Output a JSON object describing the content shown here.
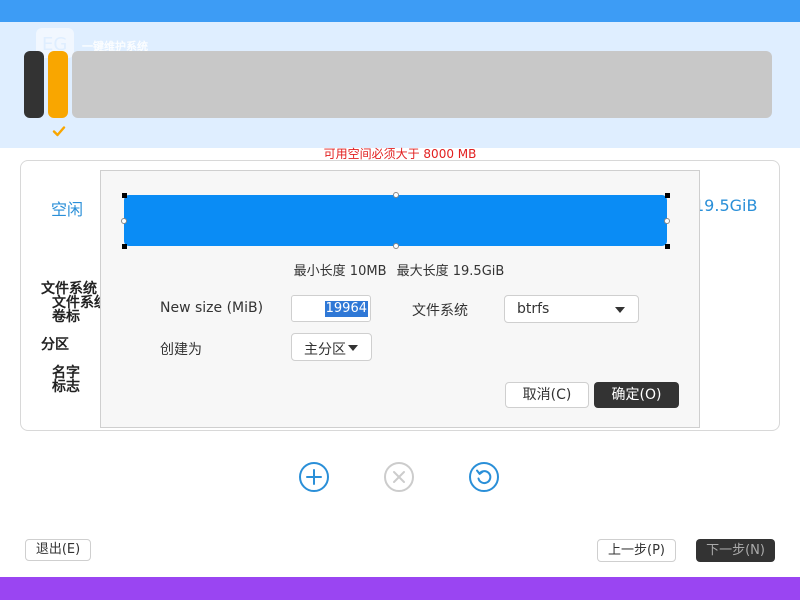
{
  "header": {
    "logo_text": "一键维护系统",
    "warning": "可用空间必须大于 8000 MB"
  },
  "card": {
    "free_label": "空闲",
    "size_label": "19.5GiB",
    "background_labels": {
      "filesystem": "文件系统",
      "filesystem_overlap": "文件系统",
      "volume": "卷标",
      "partition": "分区",
      "name": "名字",
      "flag": "标志"
    }
  },
  "dialog": {
    "min_length": "最小长度 10MB",
    "max_length": "最大长度 19.5GiB",
    "size_label": "New size (MiB)",
    "size_value": "19964",
    "filesystem_label": "文件系统",
    "filesystem_value": "btrfs",
    "create_as_label": "创建为",
    "create_as_value": "主分区",
    "cancel_label": "取消(C)",
    "ok_label": "确定(O)"
  },
  "footer": {
    "exit_label": "退出(E)",
    "prev_label": "上一步(P)",
    "next_label": "下一步(N)"
  },
  "icons": {
    "add": "plus-circle-icon",
    "remove": "x-circle-icon",
    "reset": "refresh-circle-icon",
    "check": "check-icon"
  },
  "colors": {
    "accent": "#3d9cf5",
    "selection": "#0a8cf5",
    "warning": "#e22020",
    "orange": "#f9a600",
    "purple": "#9a45f2"
  }
}
